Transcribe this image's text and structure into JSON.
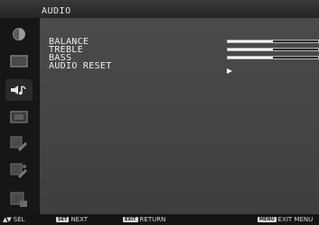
{
  "header": {
    "title": "AUDIO"
  },
  "sidebar": {
    "icons": [
      {
        "name": "contrast-icon"
      },
      {
        "name": "screen-icon"
      },
      {
        "name": "audio-icon",
        "active": true
      },
      {
        "name": "picture-icon"
      },
      {
        "name": "tools-icon"
      },
      {
        "name": "advanced-tools-icon"
      },
      {
        "name": "information-icon"
      }
    ]
  },
  "menu": {
    "items": [
      {
        "label": "BALANCE",
        "level": 0.5
      },
      {
        "label": "TREBLE",
        "level": 0.5
      },
      {
        "label": "BASS",
        "level": 0.5
      },
      {
        "label": "AUDIO RESET",
        "action": "arrow"
      }
    ]
  },
  "footer": {
    "sel_label": "SEL",
    "next_key": "SET",
    "next_label": "NEXT",
    "return_key": "EXIT",
    "return_label": "RETURN",
    "exitmenu_key": "MENU",
    "exitmenu_label": "EXIT MENU"
  },
  "colors": {
    "bar_fill": "#ffffff",
    "panel": "#454545",
    "header": "#2e2e2e"
  }
}
